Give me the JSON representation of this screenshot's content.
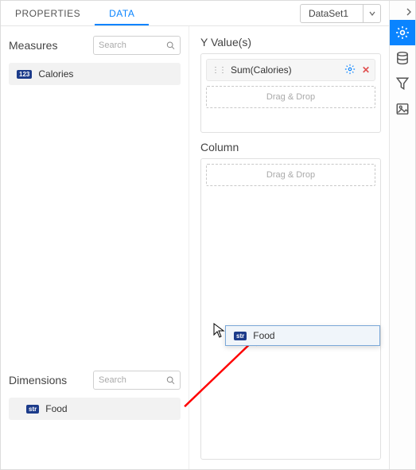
{
  "tabs": {
    "properties": "PROPERTIES",
    "data": "DATA"
  },
  "dataset": {
    "selected": "DataSet1"
  },
  "left": {
    "measures_title": "Measures",
    "dimensions_title": "Dimensions",
    "search_placeholder": "Search",
    "measure_items": [
      {
        "badge": "123",
        "label": "Calories"
      }
    ],
    "dimension_items": [
      {
        "badge": "str",
        "label": "Food"
      }
    ]
  },
  "right": {
    "yvalues_title": "Y Value(s)",
    "column_title": "Column",
    "drag_drop_text": "Drag & Drop",
    "yvalue_pill": {
      "label": "Sum(Calories)"
    }
  },
  "drag_ghost": {
    "badge": "str",
    "label": "Food"
  }
}
